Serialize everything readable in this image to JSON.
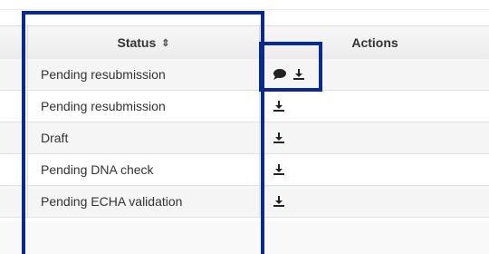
{
  "table": {
    "columns": {
      "status": "Status",
      "actions": "Actions"
    },
    "rows": [
      {
        "status": "Pending resubmission",
        "actions": [
          "comment-icon",
          "download-icon"
        ]
      },
      {
        "status": "Pending resubmission",
        "actions": [
          "download-icon"
        ]
      },
      {
        "status": "Draft",
        "actions": [
          "download-icon"
        ]
      },
      {
        "status": "Pending DNA check",
        "actions": [
          "download-icon"
        ]
      },
      {
        "status": "Pending ECHA validation",
        "actions": [
          "download-icon"
        ]
      }
    ]
  },
  "colors": {
    "highlight": "#0b2a8c",
    "header_bg": "#ececec",
    "stripe": "#f5f5f5",
    "text": "#333333"
  }
}
